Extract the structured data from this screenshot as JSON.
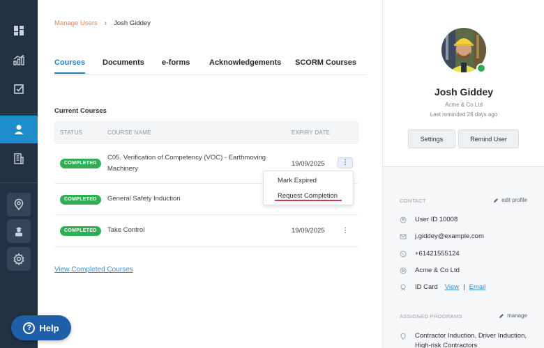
{
  "breadcrumb": {
    "parent": "Manage Users",
    "separator": "›",
    "current": "Josh Giddey"
  },
  "tabs": [
    {
      "label": "Courses",
      "active": true
    },
    {
      "label": "Documents"
    },
    {
      "label": "e-forms"
    },
    {
      "label": "Acknowledgements"
    },
    {
      "label": "SCORM Courses"
    }
  ],
  "courses": {
    "section_title": "Current Courses",
    "columns": {
      "status": "STATUS",
      "name": "COURSE NAME",
      "expiry": "EXPIRY DATE"
    },
    "rows": [
      {
        "status": "COMPLETED",
        "name": "C05. Verification of Competency (VOC) - Earthmoving Machinery",
        "expiry": "19/09/2025",
        "menu": "⋮"
      },
      {
        "status": "COMPLETED",
        "name": "General Safety Induction",
        "expiry": "",
        "menu": "⋮"
      },
      {
        "status": "COMPLETED",
        "name": "Take Control",
        "expiry": "19/09/2025",
        "menu": "⋮"
      }
    ],
    "view_completed": "View Completed Courses"
  },
  "row_menu": {
    "items": [
      "Mark Expired",
      "Request Completion"
    ]
  },
  "profile": {
    "name": "Josh Giddey",
    "company": "Acme & Co Ltd",
    "last_reminded": "Last reminded 26 days ago",
    "settings_label": "Settings",
    "remind_label": "Remind User",
    "status_color": "#2fae55"
  },
  "contact": {
    "heading": "CONTACT",
    "edit_label": "edit profile",
    "user_id": "User ID 10008",
    "email": "j.giddey@example.com",
    "phone": "+61421555124",
    "company": "Acme & Co Ltd",
    "id_card_label": "ID Card",
    "id_card_view": "View",
    "id_card_sep": "|",
    "id_card_email": "Email"
  },
  "programs": {
    "heading": "ASSIGNED PROGRAMS",
    "manage_label": "manage",
    "text": "Contractor Induction, Driver Induction, High-risk Contractors"
  },
  "help": {
    "icon": "?",
    "label": "Help"
  },
  "colors": {
    "sidebar": "#233144",
    "sidebar_active": "#1d8ec9",
    "accent": "#1f7fc0",
    "badge": "#2fae55",
    "breadcrumb_link": "#e0834f"
  }
}
